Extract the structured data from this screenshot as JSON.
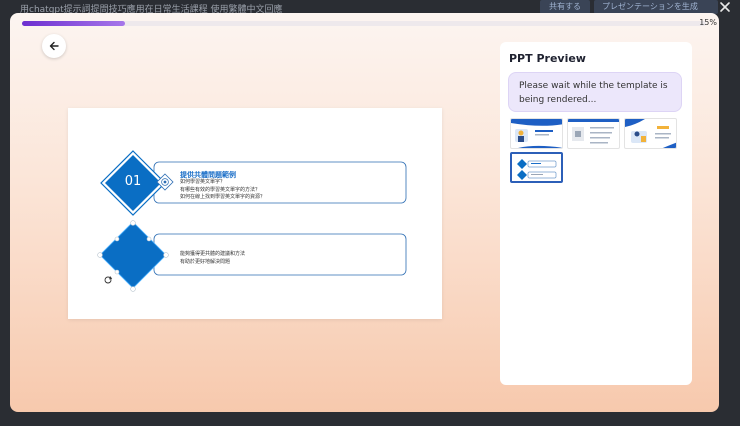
{
  "background": {
    "document_title": "用chatgpt提示詞提問技巧應用在日常生活課程 使用繁體中文回應",
    "share_button": "共有する",
    "generate_button": "プレゼンテーションを生成"
  },
  "progress": {
    "percent": 15,
    "label": "15%"
  },
  "slide": {
    "item1": {
      "number": "01",
      "title": "提供共體問題範例",
      "lines": [
        "如何學習英文單字？",
        "有哪些有效的學習英文單字的方法？",
        "如何在線上找到學習英文單字的資源？"
      ]
    },
    "item2": {
      "lines": [
        "能夠獲得更共體的建議和方法",
        "有助於更好地解決問題"
      ]
    }
  },
  "preview": {
    "title": "PPT Preview",
    "status": "Please wait while the template is being rendered..."
  },
  "colors": {
    "accent_purple": "#6d2fd0",
    "slide_blue": "#0a6ec4",
    "outline_blue": "#2c6db3"
  },
  "icons": {
    "back": "arrow-left-icon",
    "close": "close-icon",
    "rotate": "rotate-handle-icon"
  }
}
